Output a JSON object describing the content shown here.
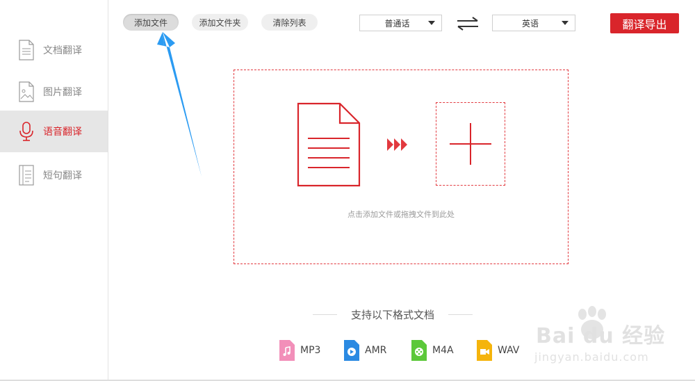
{
  "sidebar": {
    "items": [
      {
        "label": "文档翻译",
        "icon": "document-icon",
        "active": false
      },
      {
        "label": "图片翻译",
        "icon": "image-icon",
        "active": false
      },
      {
        "label": "语音翻译",
        "icon": "microphone-icon",
        "active": true
      },
      {
        "label": "短句翻译",
        "icon": "text-lines-icon",
        "active": false
      }
    ]
  },
  "toolbar": {
    "add_file": "添加文件",
    "add_folder": "添加文件夹",
    "clear_list": "清除列表",
    "source_language": "普通话",
    "target_language": "英语",
    "swap_icon": "swap-arrows-icon",
    "export": "翻译导出"
  },
  "dropzone": {
    "hint": "点击添加文件或拖拽文件到此处",
    "file_icon": "document-icon",
    "arrows_icon": "triple-chevron-right-icon",
    "add_icon": "plus-icon"
  },
  "formats": {
    "title": "支持以下格式文档",
    "items": [
      {
        "label": "MP3",
        "icon": "music-file-icon",
        "color": "#f28fb9"
      },
      {
        "label": "AMR",
        "icon": "play-file-icon",
        "color": "#2b8ae2"
      },
      {
        "label": "M4A",
        "icon": "reel-file-icon",
        "color": "#5cc83a"
      },
      {
        "label": "WAV",
        "icon": "video-file-icon",
        "color": "#f5b40c"
      }
    ]
  },
  "watermark": {
    "brand": "Bai du 经验",
    "url": "jingyan.baidu.com"
  },
  "colors": {
    "accent": "#d9252b",
    "annotation_arrow": "#2b9bf2"
  }
}
